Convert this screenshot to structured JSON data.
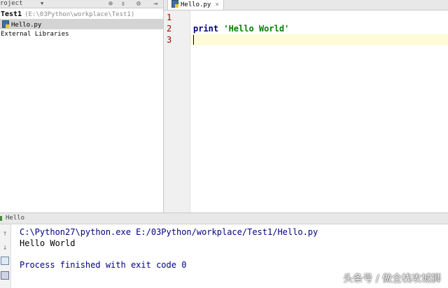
{
  "project_panel": {
    "title": "roject",
    "dropdown_glyph": "▼",
    "toolbar_icons": [
      "target-icon",
      "collapse-icon",
      "gear-icon",
      "hide-icon"
    ],
    "toolbar_glyphs": [
      "⊕",
      "⇕",
      "⚙",
      "⇥"
    ],
    "root": {
      "name": "Test1",
      "path": "(E:\\03Python\\workplace\\Test1)"
    },
    "file": {
      "name": "Hello.py"
    },
    "libraries": "External Libraries"
  },
  "editor": {
    "tab": {
      "name": "Hello.py",
      "close": "×"
    },
    "line_numbers": [
      "1",
      "2",
      "3"
    ],
    "code": {
      "keyword": "print",
      "string": "'Hello World'"
    }
  },
  "run_panel": {
    "title": "Hello",
    "toolbar_glyphs": {
      "up": "↑",
      "down": "↓"
    },
    "console": {
      "command": "C:\\Python27\\python.exe E:/03Python/workplace/Test1/Hello.py",
      "output": "Hello World",
      "exit": "Process finished with exit code 0"
    }
  },
  "watermark": "头条号 / 做全栈攻城狮",
  "colors": {
    "keyword": "#000080",
    "string": "#008000",
    "line_number": "#aa0000",
    "current_line": "#fffbd9"
  }
}
